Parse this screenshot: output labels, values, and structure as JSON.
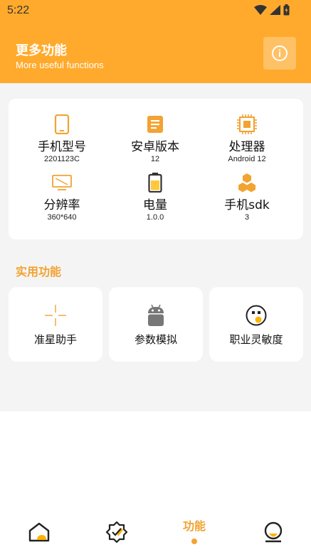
{
  "status_bar": {
    "time": "5:22"
  },
  "header": {
    "title": "更多功能",
    "subtitle": "More useful functions",
    "info_icon": "info-icon"
  },
  "device_info": [
    {
      "icon": "phone-icon",
      "label": "手机型号",
      "value": "2201123C"
    },
    {
      "icon": "document-icon",
      "label": "安卓版本",
      "value": "12"
    },
    {
      "icon": "cpu-icon",
      "label": "处理器",
      "value": "Android 12"
    },
    {
      "icon": "screen-icon",
      "label": "分辨率",
      "value": "360*640"
    },
    {
      "icon": "battery-icon",
      "label": "电量",
      "value": "1.0.0"
    },
    {
      "icon": "hexagon-icon",
      "label": "手机sdk",
      "value": "3"
    }
  ],
  "section": {
    "title": "实用功能"
  },
  "features": [
    {
      "icon": "crosshair-icon",
      "label": "准星助手"
    },
    {
      "icon": "android-icon",
      "label": "参数模拟"
    },
    {
      "icon": "face-icon",
      "label": "职业灵敏度"
    }
  ],
  "bottom_nav": {
    "items": [
      {
        "icon": "home-icon"
      },
      {
        "icon": "badge-check-icon"
      },
      {
        "label": "功能",
        "active": true
      },
      {
        "icon": "profile-icon"
      }
    ]
  },
  "colors": {
    "accent": "#FFAA2C",
    "accent_text": "#F2A332",
    "background": "#F4F4F4"
  }
}
